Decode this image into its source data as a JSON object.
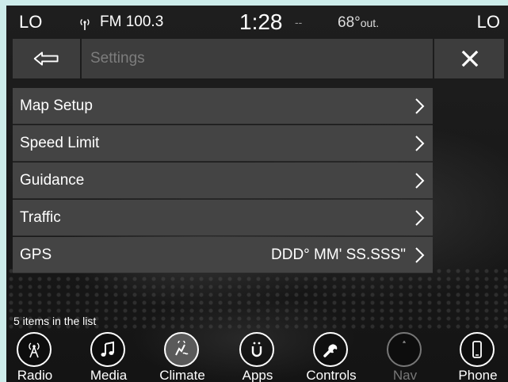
{
  "status_bar": {
    "zone_left": "LO",
    "zone_right": "LO",
    "radio_band": "FM 100.3",
    "clock": "1:28",
    "clock_suffix": "--",
    "temperature": "68°",
    "temperature_suffix": "out."
  },
  "header": {
    "title": "Settings",
    "back_icon": "back-arrow-icon",
    "close_icon": "close-icon"
  },
  "list": {
    "items": [
      {
        "label": "Map Setup",
        "value": ""
      },
      {
        "label": "Speed Limit",
        "value": ""
      },
      {
        "label": "Guidance",
        "value": ""
      },
      {
        "label": "Traffic",
        "value": ""
      },
      {
        "label": "GPS",
        "value": "DDD° MM' SS.SSS\""
      }
    ],
    "count_text": "5 items in the list"
  },
  "nav": {
    "items": [
      {
        "label": "Radio",
        "icon": "radio-tower-icon",
        "enabled": true
      },
      {
        "label": "Media",
        "icon": "music-note-icon",
        "enabled": true
      },
      {
        "label": "Climate",
        "icon": "climate-icon",
        "enabled": true
      },
      {
        "label": "Apps",
        "icon": "apps-icon",
        "enabled": true
      },
      {
        "label": "Controls",
        "icon": "wrench-icon",
        "enabled": true
      },
      {
        "label": "Nav",
        "icon": "compass-icon",
        "enabled": false
      },
      {
        "label": "Phone",
        "icon": "phone-icon",
        "enabled": true
      }
    ]
  },
  "colors": {
    "background": "#1a1a1a",
    "row": "#444444",
    "header": "#3d3d3d",
    "text": "#ffffff",
    "disabled": "#777777"
  }
}
